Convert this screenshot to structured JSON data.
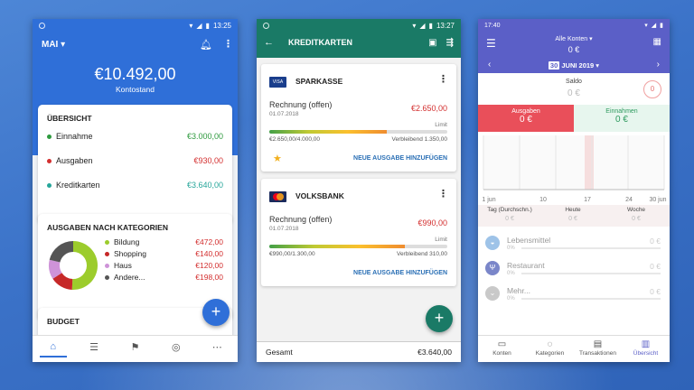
{
  "phone1": {
    "status_time": "13:25",
    "month": "MAI",
    "balance": "€10.492,00",
    "balance_label": "Kontostand",
    "overview": {
      "title": "ÜBERSICHT",
      "rows": [
        {
          "label": "Einnahme",
          "value": "€3.000,00",
          "color": "#2e9a3e"
        },
        {
          "label": "Ausgaben",
          "value": "€930,00",
          "color": "#d32f2f"
        },
        {
          "label": "Kreditkarten",
          "value": "€3.640,00",
          "color": "#26a69a"
        }
      ]
    },
    "categories": {
      "title": "AUSGABEN NACH KATEGORIEN",
      "items": [
        {
          "label": "Bildung",
          "value": "€472,00",
          "color": "#9ccc2c",
          "share": 47.2
        },
        {
          "label": "Shopping",
          "value": "€140,00",
          "color": "#c62828",
          "share": 14
        },
        {
          "label": "Haus",
          "value": "€120,00",
          "color": "#ce93d8",
          "share": 12
        },
        {
          "label": "Andere...",
          "value": "€198,00",
          "color": "#555555",
          "share": 19.8
        }
      ]
    },
    "budget_title": "BUDGET",
    "fab": "+",
    "nav": [
      "home-icon",
      "list-icon",
      "flag-icon",
      "target-icon",
      "more-icon"
    ]
  },
  "phone2": {
    "status_time": "13:27",
    "title": "KREDITKARTEN",
    "cards": [
      {
        "bank": "SPARKASSE",
        "logo": "VISA",
        "item": "Rechnung (offen)",
        "date": "01.07.2018",
        "amount": "€2.650,00",
        "limit_label": "Limit",
        "used": "€2.650,00/4.000,00",
        "remaining": "Verbleibend 1.350,00",
        "fill": 0.66,
        "action": "NEUE AUSGABE HINZUFÜGEN",
        "star": "★"
      },
      {
        "bank": "VOLKSBANK",
        "logo": "MC",
        "item": "Rechnung (offen)",
        "date": "01.07.2018",
        "amount": "€990,00",
        "limit_label": "Limit",
        "used": "€990,00/1.300,00",
        "remaining": "Verbleibend 310,00",
        "fill": 0.76,
        "action": "NEUE AUSGABE HINZUFÜGEN"
      }
    ],
    "fab": "+",
    "total_label": "Gesamt",
    "total_value": "€3.640,00"
  },
  "phone3": {
    "status_time": "17:40",
    "account": "Alle Konten",
    "account_value": "0 €",
    "day": "30",
    "month": "JUNI 2019",
    "saldo_label": "Saldo",
    "saldo_value": "0 €",
    "saldo_badge": "0",
    "expense_label": "Ausgaben",
    "expense_value": "0 €",
    "income_label": "Einnahmen",
    "income_value": "0 €",
    "x_ticks": [
      "1 jun",
      "10",
      "17",
      "24",
      "30 jun"
    ],
    "stats": [
      {
        "label": "Tag (Durchschn.)",
        "value": "0 €"
      },
      {
        "label": "Heute",
        "value": "0 €"
      },
      {
        "label": "Woche",
        "value": "0 €"
      }
    ],
    "list": [
      {
        "label": "Lebensmittel",
        "pct": "0%",
        "value": "0 €"
      },
      {
        "label": "Restaurant",
        "pct": "0%",
        "value": "0 €"
      },
      {
        "label": "Mehr...",
        "pct": "0%",
        "value": "0 €"
      }
    ],
    "nav": [
      {
        "label": "Konten"
      },
      {
        "label": "Kategorien"
      },
      {
        "label": "Transaktionen"
      },
      {
        "label": "Übersicht"
      }
    ]
  }
}
